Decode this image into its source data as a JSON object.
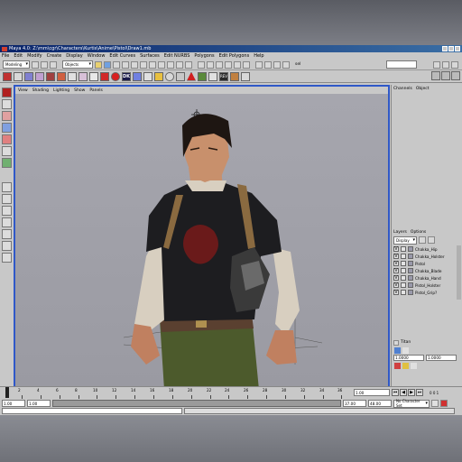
{
  "window": {
    "title": "Maya 4.0: Z:\\mm\\cgr\\Characters\\Kurtis\\Anime\\Pistol\\Draw1.mb"
  },
  "menubar": [
    "File",
    "Edit",
    "Modify",
    "Create",
    "Display",
    "Window",
    "Edit Curves",
    "Surfaces",
    "Edit NURBS",
    "Polygons",
    "Edit Polygons",
    "Help"
  ],
  "statusline": {
    "mode": "Modeling",
    "selection_mode": "Objects",
    "sel_label": "sel"
  },
  "shelf_labels": {
    "dk": "DK",
    "rev": "REV"
  },
  "panel_menu": [
    "View",
    "Shading",
    "Lighting",
    "Show",
    "Panels"
  ],
  "channel_box": {
    "tabs": [
      "Channels",
      "Object"
    ]
  },
  "layers": {
    "tabs": [
      "Layers",
      "Options"
    ],
    "display_mode": "Display",
    "rows": [
      {
        "name": "Chakka_Hip",
        "visible": "V"
      },
      {
        "name": "Chakka_Holster",
        "visible": "V"
      },
      {
        "name": "Pistol",
        "visible": "V"
      },
      {
        "name": "Chakka_Blade",
        "visible": "V"
      },
      {
        "name": "Chakka_Hand",
        "visible": "V"
      },
      {
        "name": "Pistol_Holster",
        "visible": "V"
      },
      {
        "name": "Pistol_Grip?",
        "visible": "V"
      }
    ]
  },
  "attribute_editor": {
    "title": "Titan",
    "field_a": "1.0000",
    "field_b": "1.0000"
  },
  "timeslider": {
    "ticks": [
      "2",
      "4",
      "6",
      "8",
      "10",
      "12",
      "14",
      "16",
      "18",
      "20",
      "22",
      "24",
      "26",
      "28",
      "30",
      "32",
      "34",
      "36"
    ],
    "current_frame": "1.00",
    "current_frame_readout": "0 0 1"
  },
  "rangeslider": {
    "start": "1.00",
    "inner_start": "1.00",
    "inner_end": "37.00",
    "end": "48.00",
    "character_set": "No Character Set"
  },
  "colors": {
    "viewport_border": "#2f58c8",
    "titlebar": "#0a246a",
    "ui_gray": "#c8c8c8"
  }
}
